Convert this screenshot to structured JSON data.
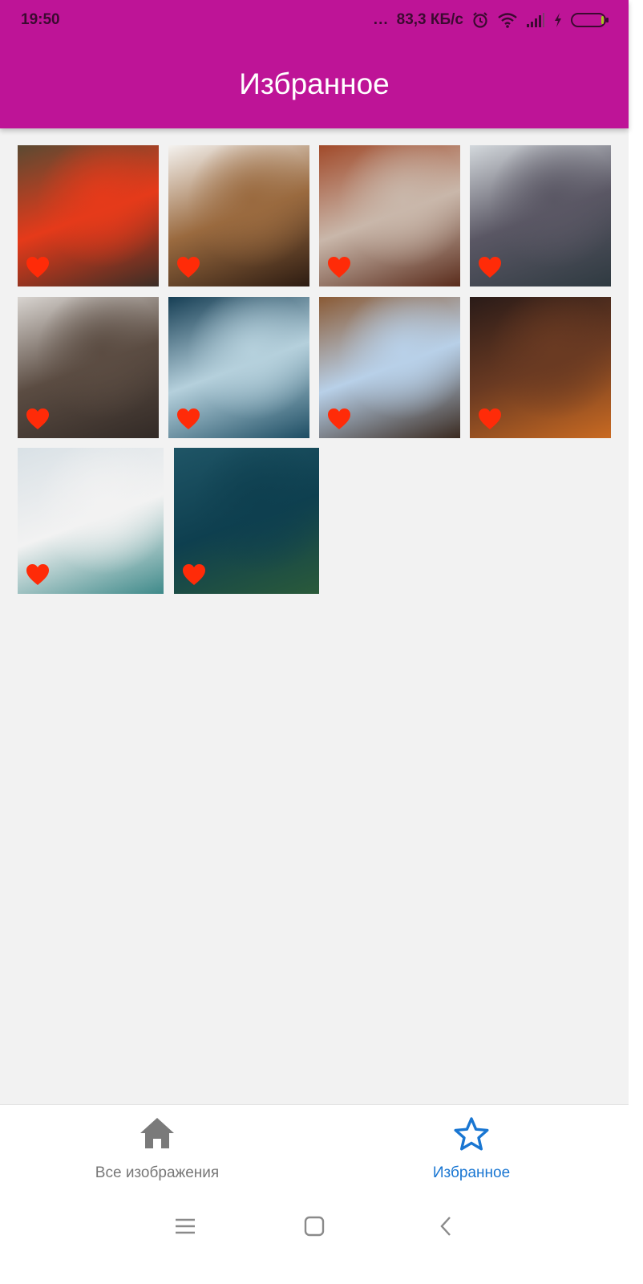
{
  "status_bar": {
    "time": "19:50",
    "dots": "...",
    "network_speed": "83,3 КБ/с",
    "icons": [
      "alarm-icon",
      "wifi-icon",
      "signal-icon",
      "charging-icon",
      "battery-icon"
    ]
  },
  "app_bar": {
    "title": "Избранное"
  },
  "colors": {
    "primary": "#be1497",
    "heart": "#ff2b08",
    "nav_active": "#1976d2",
    "nav_inactive": "#777777",
    "background": "#f2f2f2"
  },
  "images": [
    {
      "id": "1",
      "favorite": true,
      "colors": [
        "#5a4a32",
        "#e53a1a",
        "#3b2e26"
      ]
    },
    {
      "id": "2",
      "favorite": true,
      "colors": [
        "#f4f2ef",
        "#9a6a3f",
        "#2d1c12"
      ]
    },
    {
      "id": "3",
      "favorite": true,
      "colors": [
        "#a14a2a",
        "#c9b7aa",
        "#5a2c1c"
      ]
    },
    {
      "id": "4",
      "favorite": true,
      "colors": [
        "#d3d8dc",
        "#5a5764",
        "#2f3a41"
      ]
    },
    {
      "id": "5",
      "favorite": true,
      "colors": [
        "#d8d4d0",
        "#5b4c42",
        "#322a26"
      ]
    },
    {
      "id": "6",
      "favorite": true,
      "colors": [
        "#173f55",
        "#b5d0dc",
        "#1d4d63"
      ]
    },
    {
      "id": "7",
      "favorite": true,
      "colors": [
        "#8a5a35",
        "#b8d0e8",
        "#3a2a20"
      ]
    },
    {
      "id": "8",
      "favorite": true,
      "colors": [
        "#2a1b18",
        "#6a3a22",
        "#c96a22"
      ]
    },
    {
      "id": "9",
      "favorite": true,
      "colors": [
        "#d9e1e6",
        "#f2f2f2",
        "#3f8a8a"
      ]
    },
    {
      "id": "10",
      "favorite": true,
      "colors": [
        "#1f5566",
        "#0e3f4f",
        "#2a5a3a"
      ]
    }
  ],
  "bottom_nav": {
    "items": [
      {
        "label": "Все изображения",
        "icon": "home-icon",
        "active": false
      },
      {
        "label": "Избранное",
        "icon": "star-icon",
        "active": true
      }
    ]
  },
  "system_nav": {
    "buttons": [
      "menu-icon",
      "home-square-icon",
      "back-icon"
    ]
  }
}
